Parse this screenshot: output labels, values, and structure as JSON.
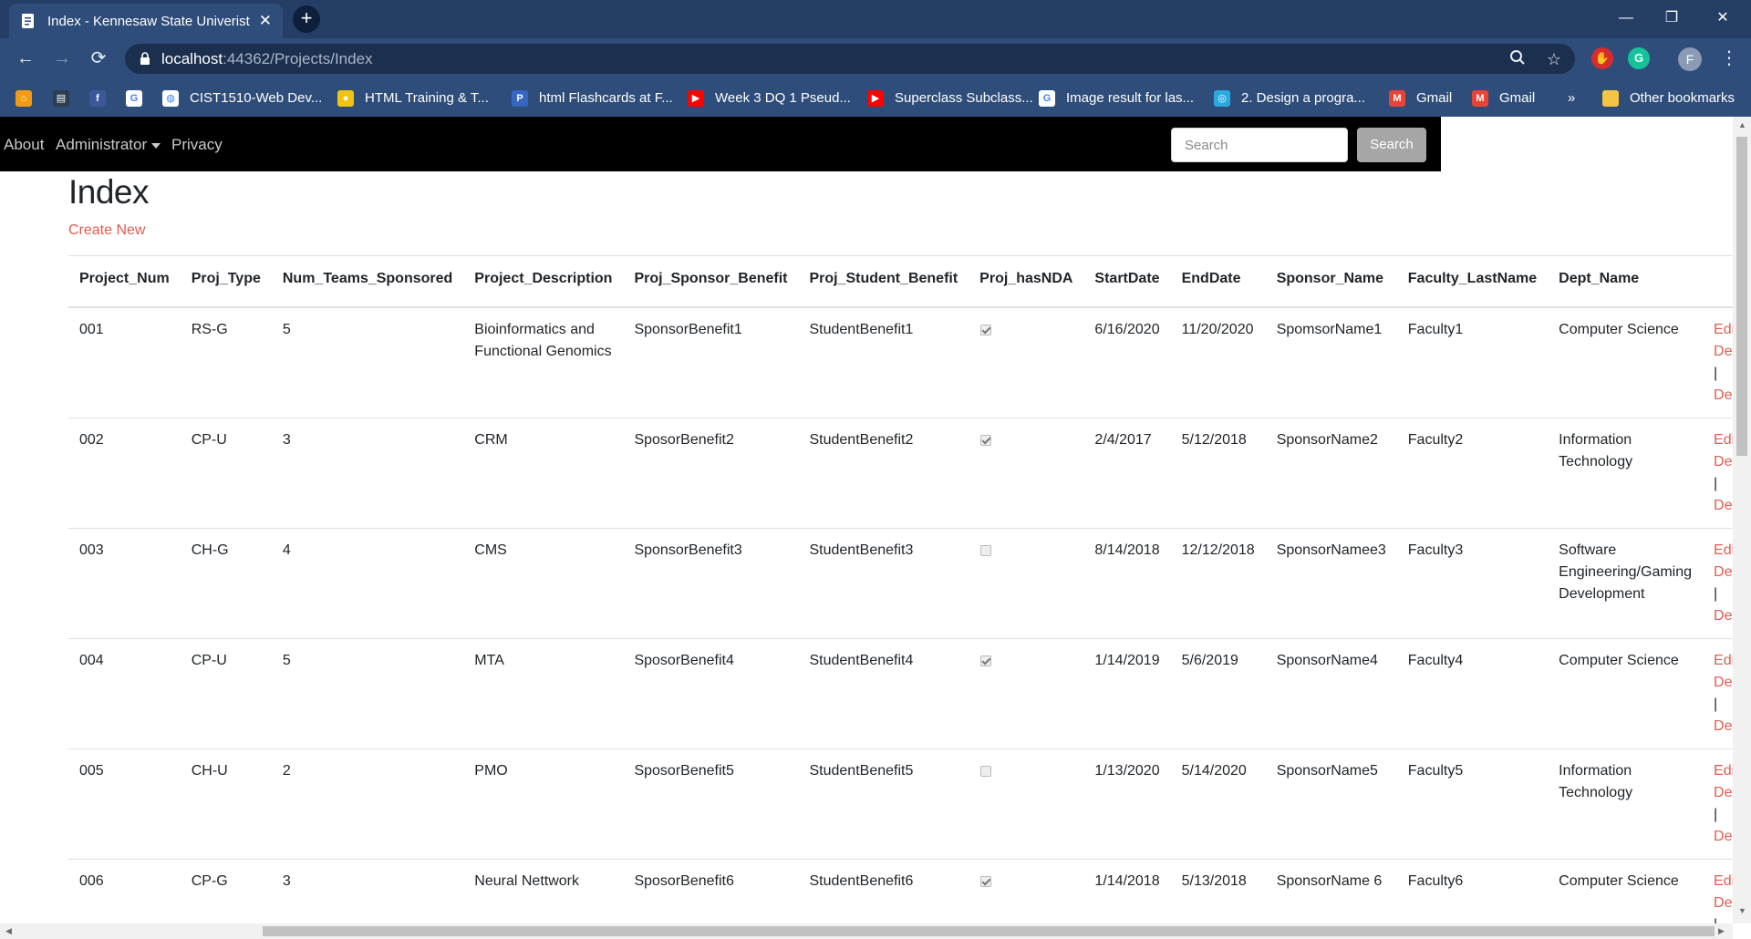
{
  "browser": {
    "tab_title": "Index - Kennesaw State Univerist",
    "url_host": "localhost",
    "url_rest": ":44362/Projects/Index",
    "profile_initial": "F",
    "bookmarks": [
      {
        "label": "",
        "icon": "home-icon",
        "color": "#f39c12"
      },
      {
        "label": "",
        "icon": "bookmark-page-icon",
        "color": "#2c3e50"
      },
      {
        "label": "",
        "icon": "facebook-icon",
        "color": "#3b5998"
      },
      {
        "label": "",
        "icon": "google-icon",
        "color": "#ffffff"
      },
      {
        "label": "CIST1510-Web Dev...",
        "icon": "globe-icon",
        "color": "#ffffff"
      },
      {
        "label": "HTML Training & T...",
        "icon": "training-icon",
        "color": "#f1c40f"
      },
      {
        "label": "html Flashcards at F...",
        "icon": "p-icon",
        "color": "#3466c2"
      },
      {
        "label": "Week 3 DQ 1 Pseud...",
        "icon": "youtube-icon",
        "color": "#ff0000"
      },
      {
        "label": "Superclass Subclass...",
        "icon": "youtube-icon",
        "color": "#ff0000"
      },
      {
        "label": "Image result for las...",
        "icon": "google-icon",
        "color": "#ffffff"
      },
      {
        "label": "2. Design a progra...",
        "icon": "att-icon",
        "color": "#2aa8e0"
      },
      {
        "label": "Gmail",
        "icon": "gmail-icon",
        "color": "#ea4335"
      },
      {
        "label": "Gmail",
        "icon": "gmail-icon",
        "color": "#ea4335"
      }
    ],
    "bookmarks_more": "»",
    "other_bookmarks": "Other bookmarks"
  },
  "nav": {
    "about": "About",
    "administrator": "Administrator",
    "privacy": "Privacy",
    "search_placeholder": "Search",
    "search_button": "Search"
  },
  "page": {
    "title": "Index",
    "create_new": "Create New"
  },
  "table": {
    "headers": [
      "Project_Num",
      "Proj_Type",
      "Num_Teams_Sponsored",
      "Project_Description",
      "Proj_Sponsor_Benefit",
      "Proj_Student_Benefit",
      "Proj_hasNDA",
      "StartDate",
      "EndDate",
      "Sponsor_Name",
      "Faculty_LastName",
      "Dept_Name"
    ],
    "actions": {
      "edit": "Edit",
      "details": "Details",
      "delete": "Delete",
      "separator": "|"
    },
    "rows": [
      {
        "num": "001",
        "type": "RS-G",
        "teams": "5",
        "desc": "Bioinformatics and Functional Genomics",
        "sponsor_benefit": "SponsorBenefit1",
        "student_benefit": "StudentBenefit1",
        "has_nda": true,
        "start": "6/16/2020",
        "end": "11/20/2020",
        "sponsor_name": "SpomsorName1",
        "faculty": "Faculty1",
        "dept": "Computer Science"
      },
      {
        "num": "002",
        "type": "CP-U",
        "teams": "3",
        "desc": "CRM",
        "sponsor_benefit": "SposorBenefit2",
        "student_benefit": "StudentBenefit2",
        "has_nda": true,
        "start": "2/4/2017",
        "end": "5/12/2018",
        "sponsor_name": "SponsorName2",
        "faculty": "Faculty2",
        "dept": "Information Technology"
      },
      {
        "num": "003",
        "type": "CH-G",
        "teams": "4",
        "desc": "CMS",
        "sponsor_benefit": "SponsorBenefit3",
        "student_benefit": "StudentBenefit3",
        "has_nda": false,
        "start": "8/14/2018",
        "end": "12/12/2018",
        "sponsor_name": "SponsorNamee3",
        "faculty": "Faculty3",
        "dept": "Software Engineering/Gaming Development"
      },
      {
        "num": "004",
        "type": "CP-U",
        "teams": "5",
        "desc": "MTA",
        "sponsor_benefit": "SposorBenefit4",
        "student_benefit": "StudentBenefit4",
        "has_nda": true,
        "start": "1/14/2019",
        "end": "5/6/2019",
        "sponsor_name": "SponsorName4",
        "faculty": "Faculty4",
        "dept": "Computer Science"
      },
      {
        "num": "005",
        "type": "CH-U",
        "teams": "2",
        "desc": "PMO",
        "sponsor_benefit": "SposorBenefit5",
        "student_benefit": "StudentBenefit5",
        "has_nda": false,
        "start": "1/13/2020",
        "end": "5/14/2020",
        "sponsor_name": "SponsorName5",
        "faculty": "Faculty5",
        "dept": "Information Technology"
      },
      {
        "num": "006",
        "type": "CP-G",
        "teams": "3",
        "desc": "Neural Nettwork",
        "sponsor_benefit": "SposorBenefit6",
        "student_benefit": "StudentBenefit6",
        "has_nda": true,
        "start": "1/14/2018",
        "end": "5/13/2018",
        "sponsor_name": "SponsorName 6",
        "faculty": "Faculty6",
        "dept": "Computer Science"
      }
    ]
  },
  "colors": {
    "tabbar": "#253e66",
    "toolbar": "#2f4d7a",
    "navbar": "#000000",
    "link": "#e35b4f"
  }
}
